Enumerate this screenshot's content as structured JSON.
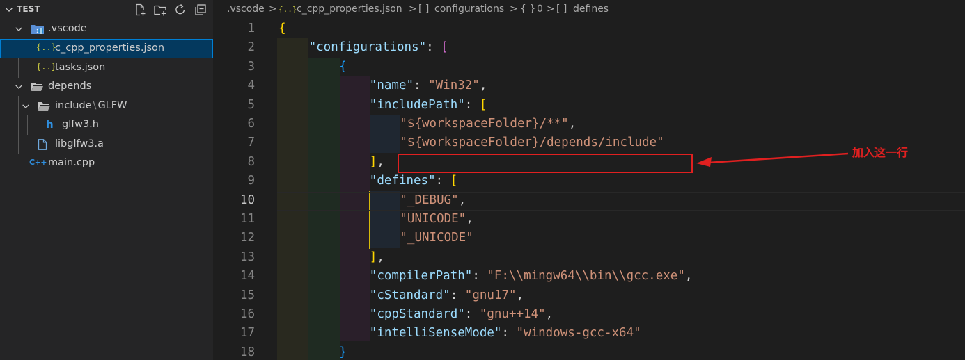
{
  "explorer": {
    "title": "TEST",
    "actions": [
      "new-file-icon",
      "new-folder-icon",
      "refresh-icon",
      "collapse-all-icon"
    ],
    "tree": [
      {
        "label": ".vscode",
        "icon": "vscode-folder-icon",
        "type": "folder",
        "expanded": true
      },
      {
        "label": "c_cpp_properties.json",
        "icon": "json-file-icon",
        "type": "file",
        "selected": true,
        "icon_text": "{..}"
      },
      {
        "label": "tasks.json",
        "icon": "json-file-icon",
        "type": "file",
        "icon_text": "{..}"
      },
      {
        "label": "depends",
        "icon": "folder-icon",
        "type": "folder",
        "expanded": true
      },
      {
        "label": "include",
        "label_sep": "\\",
        "label_tail": "GLFW",
        "icon": "folder-icon",
        "type": "folder",
        "expanded": true
      },
      {
        "label": "glfw3.h",
        "icon": "header-file-icon",
        "type": "file",
        "icon_text": "h"
      },
      {
        "label": "libglfw3.a",
        "icon": "file-icon",
        "type": "file"
      },
      {
        "label": "main.cpp",
        "icon": "cpp-file-icon",
        "type": "file",
        "icon_text": "C++"
      }
    ]
  },
  "breadcrumb": {
    "items": [
      ".vscode",
      "c_cpp_properties.json",
      "configurations",
      "0",
      "defines"
    ],
    "icons": [
      "",
      "{..}",
      "[ ]",
      "{ }",
      "[ ]"
    ],
    "separator": ">"
  },
  "editor": {
    "active_line": 10,
    "lines": [
      {
        "num": "1",
        "tokens": [
          [
            "b1",
            "{"
          ]
        ]
      },
      {
        "num": "2",
        "tokens": [
          [
            "key",
            "\"configurations\""
          ],
          [
            "punct",
            ": "
          ],
          [
            "b2",
            "["
          ]
        ]
      },
      {
        "num": "3",
        "tokens": [
          [
            "b3",
            "{"
          ]
        ]
      },
      {
        "num": "4",
        "tokens": [
          [
            "key",
            "\"name\""
          ],
          [
            "punct",
            ": "
          ],
          [
            "str",
            "\"Win32\""
          ],
          [
            "punct",
            ","
          ]
        ]
      },
      {
        "num": "5",
        "tokens": [
          [
            "key",
            "\"includePath\""
          ],
          [
            "punct",
            ": "
          ],
          [
            "b1",
            "["
          ]
        ]
      },
      {
        "num": "6",
        "tokens": [
          [
            "str",
            "\"${workspaceFolder}/**\""
          ],
          [
            "punct",
            ","
          ]
        ]
      },
      {
        "num": "7",
        "tokens": [
          [
            "str",
            "\"${workspaceFolder}/depends/include\""
          ]
        ]
      },
      {
        "num": "8",
        "tokens": [
          [
            "b1",
            "]"
          ],
          [
            "punct",
            ","
          ]
        ]
      },
      {
        "num": "9",
        "tokens": [
          [
            "key",
            "\"defines\""
          ],
          [
            "punct",
            ": "
          ],
          [
            "b1",
            "["
          ]
        ]
      },
      {
        "num": "10",
        "tokens": [
          [
            "str",
            "\"_DEBUG\""
          ],
          [
            "punct",
            ","
          ]
        ]
      },
      {
        "num": "11",
        "tokens": [
          [
            "str",
            "\"UNICODE\""
          ],
          [
            "punct",
            ","
          ]
        ]
      },
      {
        "num": "12",
        "tokens": [
          [
            "str",
            "\"_UNICODE\""
          ]
        ]
      },
      {
        "num": "13",
        "tokens": [
          [
            "b1",
            "]"
          ],
          [
            "punct",
            ","
          ]
        ]
      },
      {
        "num": "14",
        "tokens": [
          [
            "key",
            "\"compilerPath\""
          ],
          [
            "punct",
            ": "
          ],
          [
            "str",
            "\"F:\\\\mingw64\\\\bin\\\\gcc.exe\""
          ],
          [
            "punct",
            ","
          ]
        ]
      },
      {
        "num": "15",
        "tokens": [
          [
            "key",
            "\"cStandard\""
          ],
          [
            "punct",
            ": "
          ],
          [
            "str",
            "\"gnu17\""
          ],
          [
            "punct",
            ","
          ]
        ]
      },
      {
        "num": "16",
        "tokens": [
          [
            "key",
            "\"cppStandard\""
          ],
          [
            "punct",
            ": "
          ],
          [
            "str",
            "\"gnu++14\""
          ],
          [
            "punct",
            ","
          ]
        ]
      },
      {
        "num": "17",
        "tokens": [
          [
            "key",
            "\"intelliSenseMode\""
          ],
          [
            "punct",
            ": "
          ],
          [
            "str",
            "\"windows-gcc-x64\""
          ]
        ]
      },
      {
        "num": "18",
        "tokens": [
          [
            "b3",
            "}"
          ]
        ]
      }
    ]
  },
  "annotation": {
    "text": "加入这一行",
    "color": "#e02020"
  },
  "colors": {
    "sidebar_bg": "#252526",
    "editor_bg": "#1e1e1e",
    "selection_bg": "#04395e",
    "selection_border": "#007fd4",
    "json_key": "#9cdcfe",
    "json_string": "#ce9178",
    "bracket_gold": "#ffd700",
    "bracket_orchid": "#da70d6",
    "bracket_blue": "#179fff"
  }
}
